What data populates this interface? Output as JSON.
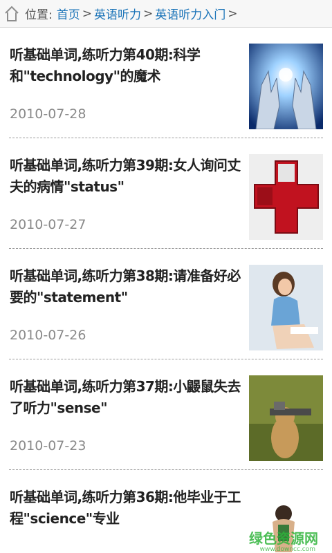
{
  "breadcrumb": {
    "label": "位置:",
    "items": [
      "首页",
      "英语听力",
      "英语听力入门"
    ],
    "separator": ">"
  },
  "articles": [
    {
      "title": "听基础单词,练听力第40期:科学和\"technology\"的魔术",
      "date": "2010-07-28",
      "thumbnail": "robot-hands-image"
    },
    {
      "title": "听基础单词,练听力第39期:女人询问丈夫的病情\"status\"",
      "date": "2010-07-27",
      "thumbnail": "red-cross-cabinet-image"
    },
    {
      "title": "听基础单词,练听力第38期:请准备好必要的\"statement\"",
      "date": "2010-07-26",
      "thumbnail": "woman-sitting-image"
    },
    {
      "title": "听基础单词,练听力第37期:小鼹鼠失去了听力\"sense\"",
      "date": "2010-07-23",
      "thumbnail": "prairie-dog-image"
    },
    {
      "title": "听基础单词,练听力第36期:他毕业于工程\"science\"专业",
      "date": "",
      "thumbnail": "yoga-person-image"
    }
  ],
  "watermark": {
    "text": "绿色资源网",
    "sub": "www.downcc.com"
  }
}
